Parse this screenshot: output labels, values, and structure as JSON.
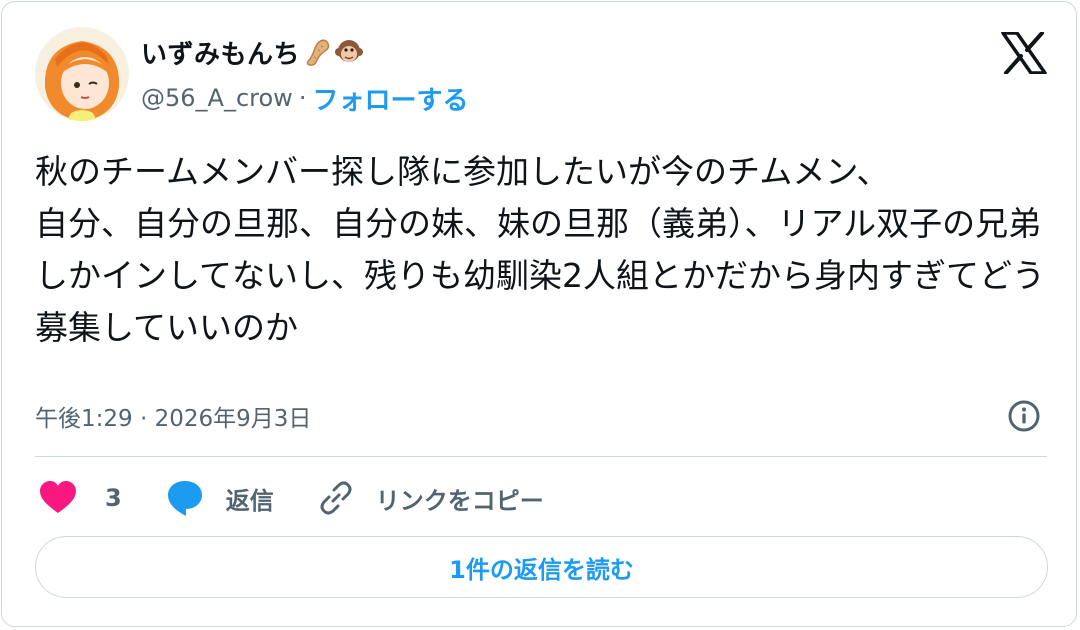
{
  "author": {
    "display_name": "いずみもんち",
    "name_emojis": [
      "peanut-emoji",
      "monkey-face-emoji"
    ],
    "handle": "@56_A_crow",
    "separator": "·",
    "follow_label": "フォローする"
  },
  "tweet": {
    "text": "秋のチームメンバー探し隊に参加したいが今のチムメン、\n自分、自分の旦那、自分の妹、妹の旦那（義弟）、リアル双子の兄弟しかインしてないし、残りも幼馴染2人組とかだから身内すぎてどう募集していいのか",
    "timestamp": "午後1:29 · 2026年9月3日"
  },
  "actions": {
    "like_count": "3",
    "reply_label": "返信",
    "copy_link_label": "リンクをコピー"
  },
  "read_replies_label": "1件の返信を読む",
  "colors": {
    "accent": "#1d9bf0",
    "like": "#f91880",
    "text": "#0f1419",
    "secondary": "#536471",
    "border": "#cfd9de"
  },
  "icons": [
    "x-logo-icon",
    "info-icon",
    "heart-icon",
    "reply-bubble-icon",
    "link-icon"
  ]
}
